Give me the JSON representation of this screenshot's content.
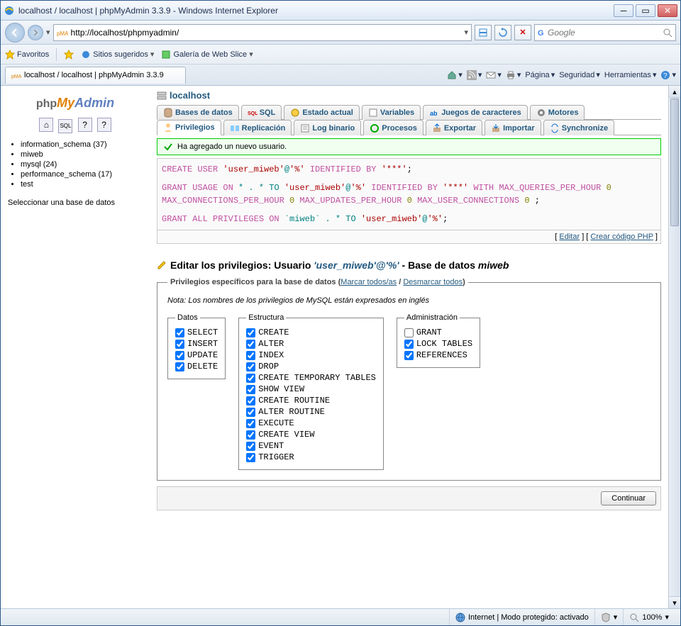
{
  "window": {
    "title": "localhost / localhost | phpMyAdmin 3.3.9 - Windows Internet Explorer"
  },
  "address": {
    "url": "http://localhost/phpmyadmin/"
  },
  "search": {
    "placeholder": "Google"
  },
  "favbar": {
    "favorites": "Favoritos",
    "suggested": "Sitios sugeridos",
    "gallery": "Galería de Web Slice"
  },
  "ietab": {
    "label": "localhost / localhost | phpMyAdmin 3.3.9"
  },
  "tabtools": {
    "page": "Página",
    "security": "Seguridad",
    "tools": "Herramientas"
  },
  "sidebar": {
    "home_title": "phpMyAdmin",
    "databases": [
      "information_schema (37)",
      "miweb",
      "mysql (24)",
      "performance_schema (17)",
      "test"
    ],
    "select_label": "Seleccionar una base de datos"
  },
  "server": {
    "label": "localhost"
  },
  "tabs": {
    "databases": "Bases de datos",
    "sql": "SQL",
    "status": "Estado actual",
    "variables": "Variables",
    "charsets": "Juegos de caracteres",
    "engines": "Motores",
    "privileges": "Privilegios",
    "replication": "Replicación",
    "binlog": "Log binario",
    "processes": "Procesos",
    "export": "Exportar",
    "import": "Importar",
    "synchronize": "Synchronize"
  },
  "success": {
    "msg": "Ha agregado un nuevo usuario."
  },
  "sql": {
    "line1a": "CREATE USER ",
    "line1b": "'user_miweb'",
    "line1c": "@",
    "line1d": "'%'",
    "line1e": " IDENTIFIED BY ",
    "line1f": "'***'",
    "line1g": ";",
    "line2a": "GRANT USAGE ON ",
    "line2b": "* . * TO ",
    "line2c": "'user_miweb'",
    "line2d": "@",
    "line2e": "'%'",
    "line2f": " IDENTIFIED BY ",
    "line2g": "'***'",
    "line2h": " WITH MAX_QUERIES_PER_HOUR ",
    "line2i": "0",
    "line3a": "MAX_CONNECTIONS_PER_HOUR ",
    "line3b": "0",
    "line3c": " MAX_UPDATES_PER_HOUR ",
    "line3d": "0",
    "line3e": " MAX_USER_CONNECTIONS ",
    "line3f": "0",
    "line3g": " ;",
    "line4a": "GRANT ALL PRIVILEGES ON ",
    "line4b": "`miweb`",
    "line4c": " . * TO ",
    "line4d": "'user_miweb'",
    "line4e": "@",
    "line4f": "'%'",
    "line4g": ";",
    "edit_link": "Editar",
    "php_link": "Crear código PHP"
  },
  "edit": {
    "title_a": "Editar los privilegios: Usuario ",
    "user": "'user_miweb'@'%'",
    "title_b": " - Base de datos ",
    "db": "miweb"
  },
  "priv": {
    "legend_a": "Privilegios específicos para la base de datos",
    "check_all": "Marcar todos/as",
    "uncheck_all": "Desmarcar todos",
    "note": "Nota: Los nombres de los privilegios de MySQL están expresados en inglés",
    "groups": {
      "data": {
        "legend": "Datos",
        "items": [
          "SELECT",
          "INSERT",
          "UPDATE",
          "DELETE"
        ]
      },
      "structure": {
        "legend": "Estructura",
        "items": [
          "CREATE",
          "ALTER",
          "INDEX",
          "DROP",
          "CREATE TEMPORARY TABLES",
          "SHOW VIEW",
          "CREATE ROUTINE",
          "ALTER ROUTINE",
          "EXECUTE",
          "CREATE VIEW",
          "EVENT",
          "TRIGGER"
        ]
      },
      "admin": {
        "legend": "Administración",
        "items": [
          "GRANT",
          "LOCK TABLES",
          "REFERENCES"
        ],
        "unchecked": [
          "GRANT"
        ]
      }
    },
    "continue": "Continuar"
  },
  "status": {
    "internet": "Internet | Modo protegido: activado",
    "zoom": "100%"
  }
}
